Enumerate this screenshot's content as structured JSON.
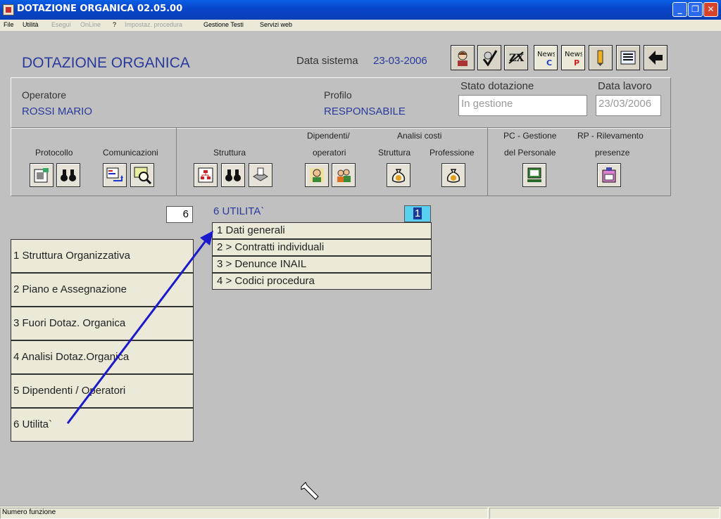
{
  "window": {
    "title": "DOTAZIONE ORGANICA 02.05.00"
  },
  "menu": [
    {
      "label": "File",
      "enabled": true
    },
    {
      "label": "Utilità",
      "enabled": true
    },
    {
      "label": "Esegui",
      "enabled": false
    },
    {
      "label": "OnLine",
      "enabled": false
    },
    {
      "label": "?",
      "enabled": true
    },
    {
      "label": "Impostaz. procedura",
      "enabled": false
    },
    {
      "label": "Gestione Testi",
      "enabled": true
    },
    {
      "label": "Servizi web",
      "enabled": true
    }
  ],
  "header": {
    "app_title": "DOTAZIONE ORGANICA",
    "data_sistema_label": "Data sistema",
    "data_sistema_value": "23-03-2006",
    "toolbar_icons": [
      "person-icon",
      "check-person-icon",
      "tax-icon",
      "news-c-icon",
      "news-p-icon",
      "pencil-icon",
      "list-icon",
      "back-arrow-icon"
    ],
    "news_c": {
      "top": "News",
      "bottom": "C"
    },
    "news_p": {
      "top": "News",
      "bottom": "P"
    }
  },
  "info": {
    "operatore_label": "Operatore",
    "operatore_value": "ROSSI MARIO",
    "profilo_label": "Profilo",
    "profilo_value": "RESPONSABILE",
    "stato_label": "Stato dotazione",
    "stato_value": "In gestione",
    "data_lavoro_label": "Data lavoro",
    "data_lavoro_value": "23/03/2006"
  },
  "functions": {
    "protocollo": "Protocollo",
    "comunicazioni": "Comunicazioni",
    "struttura": "Struttura",
    "dipendenti_1": "Dipendenti/",
    "dipendenti_2": "operatori",
    "analisi_costi": "Analisi costi",
    "analisi_struttura": "Struttura",
    "analisi_professione": "Professione",
    "pc_1": "PC - Gestione",
    "pc_2": "del Personale",
    "rp_1": "RP - Rilevamento",
    "rp_2": "presenze"
  },
  "menu_main": {
    "selected_number": "6",
    "items": [
      "1 Struttura Organizzativa",
      "2 Piano e Assegnazione",
      "3 Fuori Dotaz. Organica",
      "4 Analisi Dotaz.Organica",
      "5 Dipendenti / Operatori",
      "6 Utilita`"
    ]
  },
  "submenu": {
    "title": "6 UTILITA`",
    "selected_number": "1",
    "items": [
      "1 Dati generali",
      "2 > Contratti individuali",
      "3 > Denunce INAIL",
      "4 > Codici procedura"
    ]
  },
  "status": {
    "text": "Numero funzione"
  },
  "colors": {
    "accent_blue": "#2a3a9c",
    "arrow": "#1a1acc",
    "titlebar": "#0845c8"
  }
}
